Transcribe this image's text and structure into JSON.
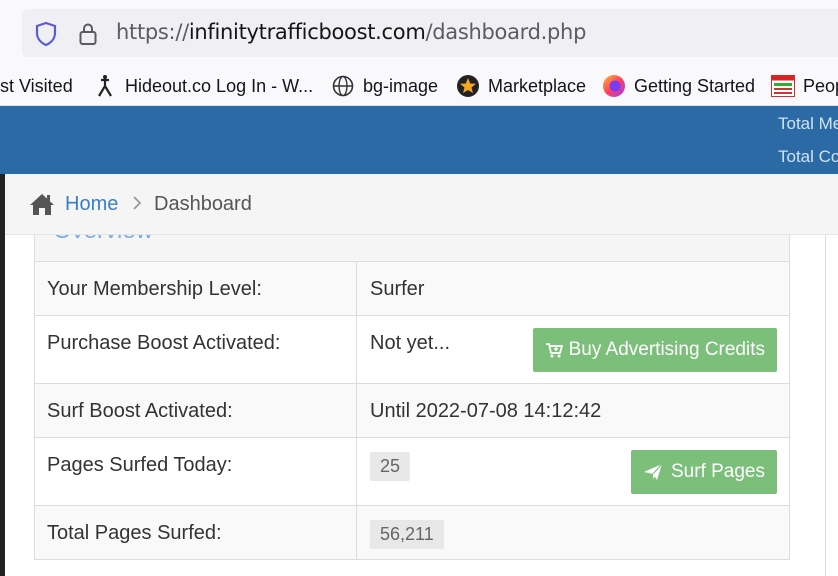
{
  "browser": {
    "url_scheme": "https://",
    "url_host": "infinitytrafficboost.com",
    "url_path": "/dashboard.php",
    "bookmarks": [
      {
        "label": "st Visited",
        "icon": "none"
      },
      {
        "label": "Hideout.co Log In - W...",
        "icon": "hideout-icon"
      },
      {
        "label": "bg-image",
        "icon": "globe-icon"
      },
      {
        "label": "Marketplace",
        "icon": "star-badge-icon"
      },
      {
        "label": "Getting Started",
        "icon": "firefox-icon"
      },
      {
        "label": "Peop",
        "icon": "bookmark-image-icon"
      }
    ]
  },
  "header": {
    "stat_1": "Total Me",
    "stat_2": "Total Co"
  },
  "breadcrumb": {
    "home": "Home",
    "separator": ">",
    "current": "Dashboard"
  },
  "panel": {
    "title": "Overview",
    "rows": [
      {
        "label": "Your Membership Level:",
        "value": "Surfer"
      },
      {
        "label": "Purchase Boost Activated:",
        "value": "Not yet...",
        "button": "Buy Advertising Credits"
      },
      {
        "label": "Surf Boost Activated:",
        "value": "Until 2022-07-08 14:12:42"
      },
      {
        "label": "Pages Surfed Today:",
        "value": "25",
        "button": "Surf Pages"
      },
      {
        "label": "Total Pages Surfed:",
        "value": "56,211"
      }
    ]
  },
  "colors": {
    "header_blue": "#2c6aa6",
    "button_green": "#7bbf7b",
    "link_blue": "#3b7fc2"
  }
}
